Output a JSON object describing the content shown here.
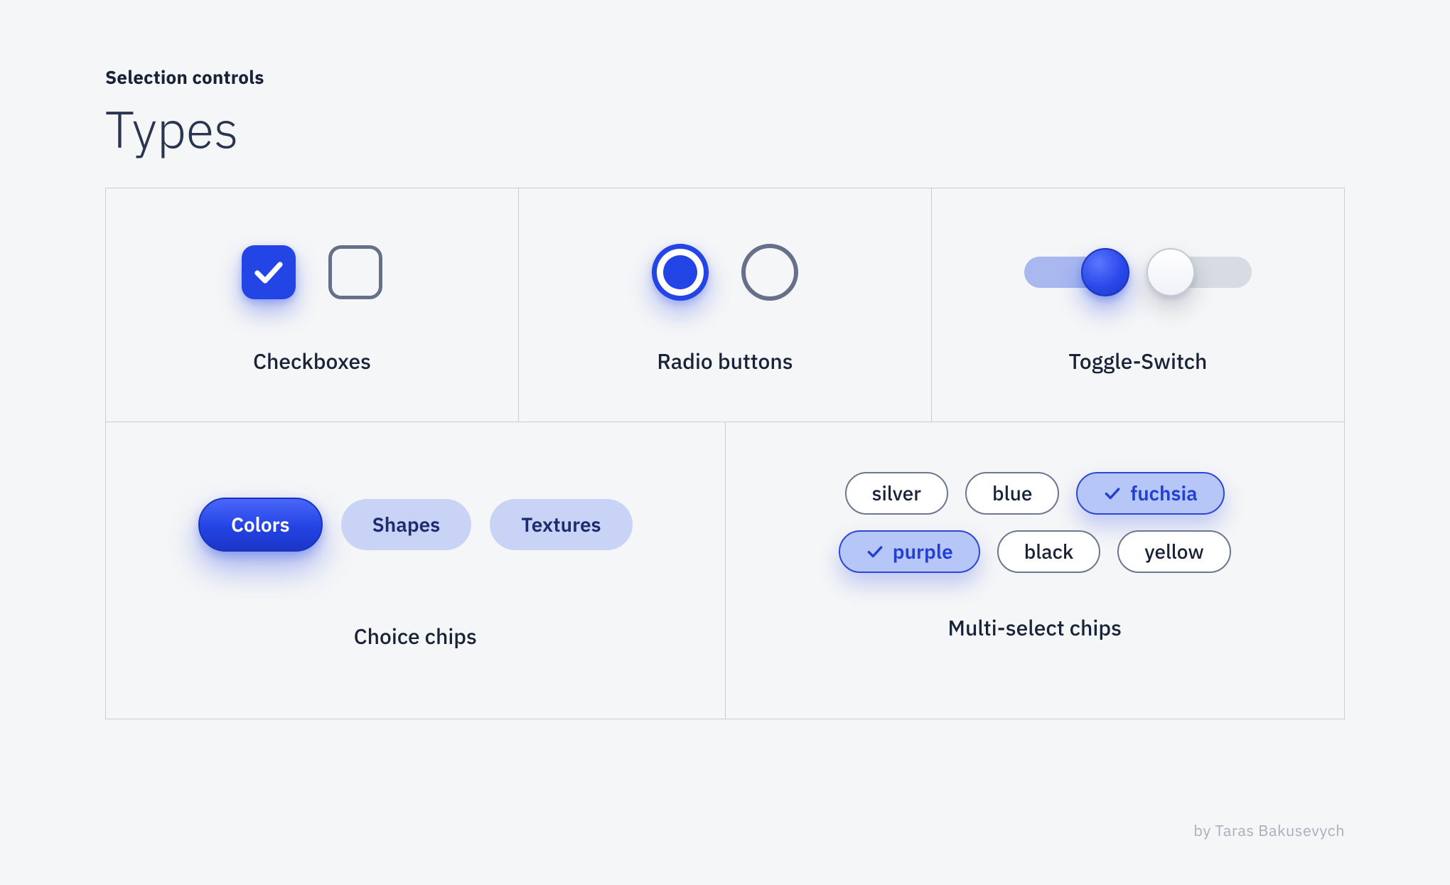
{
  "header": {
    "eyebrow": "Selection controls",
    "title": "Types"
  },
  "panels": {
    "checkboxes": {
      "label": "Checkboxes"
    },
    "radios": {
      "label": "Radio buttons"
    },
    "toggles": {
      "label": "Toggle-Switch"
    },
    "choice": {
      "label": "Choice chips",
      "items": [
        "Colors",
        "Shapes",
        "Textures"
      ],
      "selected_index": 0
    },
    "multi": {
      "label": "Multi-select chips",
      "row1": [
        {
          "label": "silver",
          "selected": false
        },
        {
          "label": "blue",
          "selected": false
        },
        {
          "label": "fuchsia",
          "selected": true
        }
      ],
      "row2": [
        {
          "label": "purple",
          "selected": true
        },
        {
          "label": "black",
          "selected": false
        },
        {
          "label": "yellow",
          "selected": false
        }
      ]
    }
  },
  "credit": "by Taras Bakusevych"
}
